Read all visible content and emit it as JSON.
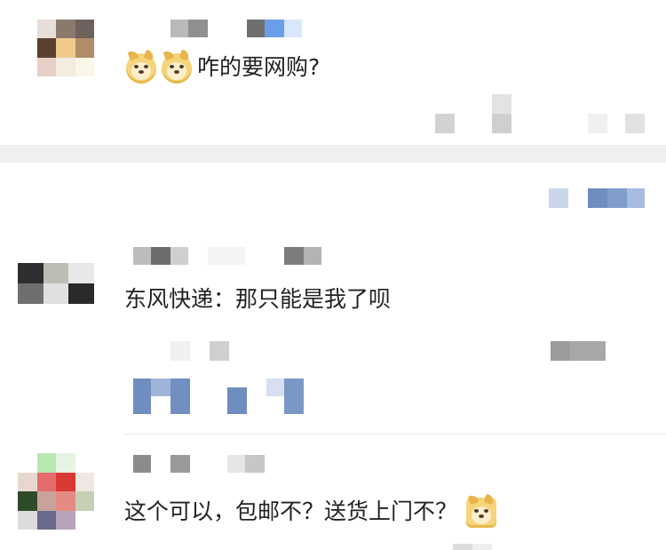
{
  "comments": [
    {
      "text": "咋的要网购?",
      "emoji_prefix": [
        "doge-emoji",
        "doge-emoji"
      ]
    },
    {
      "text": "东风快递：那只能是我了呗"
    },
    {
      "text": "这个可以，包邮不？送货上门不？",
      "emoji_suffix": "doge-emoji"
    }
  ],
  "colors": {
    "text": "#222222",
    "section_band": "#efefef",
    "link_blue": "#6f8ebf",
    "pixel_gray": "#cfcfcf"
  }
}
